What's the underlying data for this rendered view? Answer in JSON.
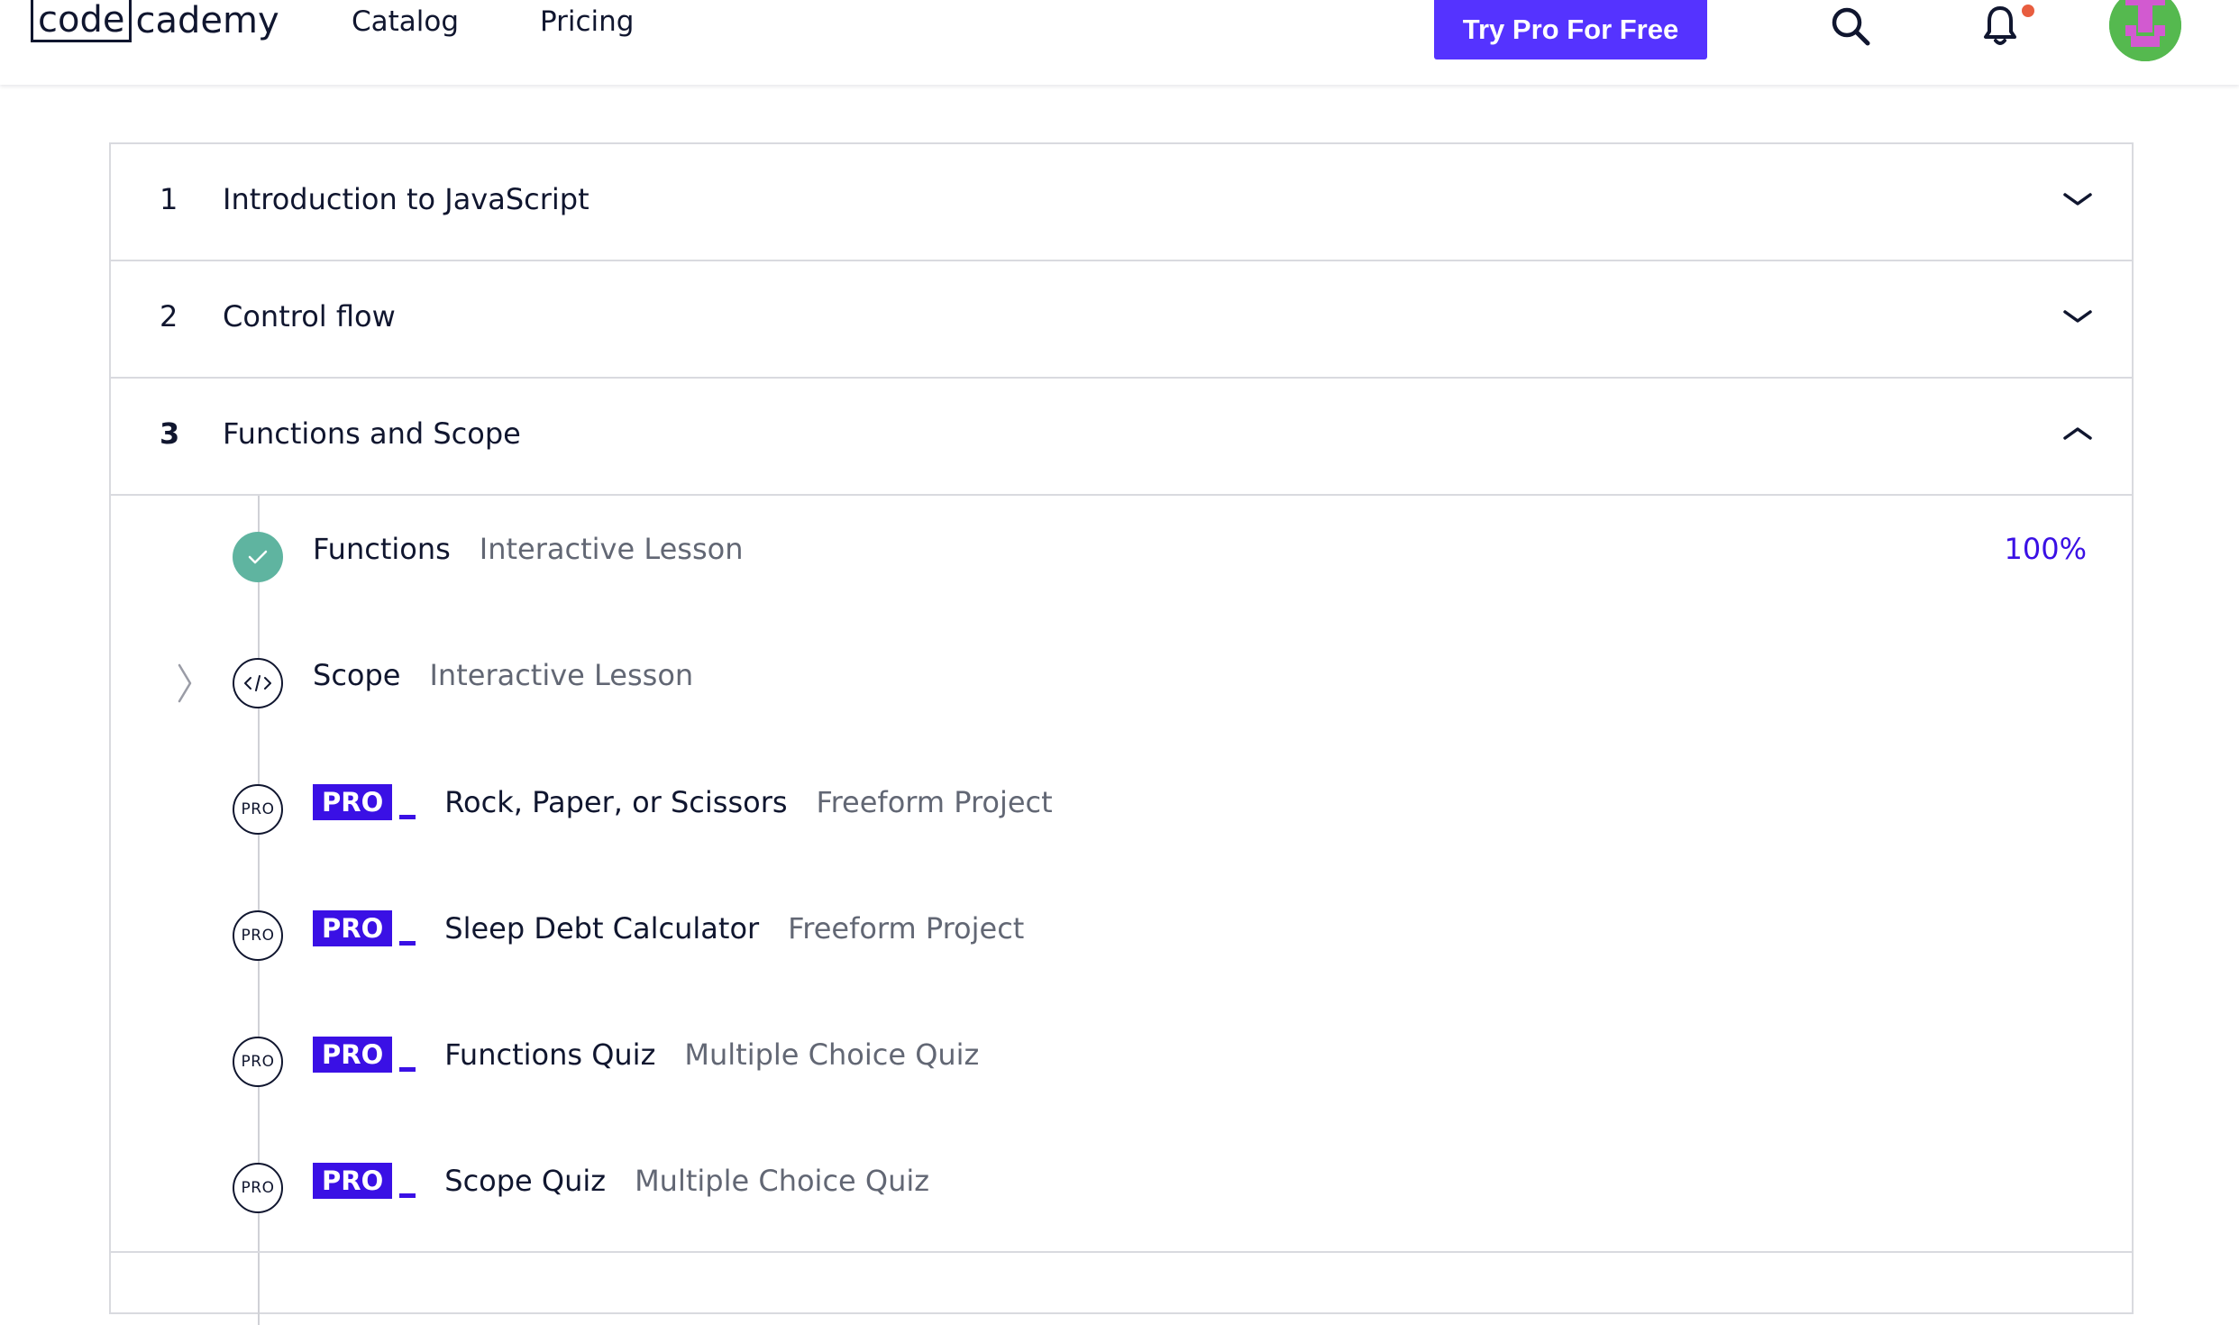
{
  "header": {
    "logo_left": "code",
    "logo_right": "cademy",
    "nav": [
      {
        "label": "Catalog"
      },
      {
        "label": "Pricing"
      }
    ],
    "cta_label": "Try Pro For Free",
    "search_icon": "search-icon",
    "notification_icon": "bell-icon",
    "avatar_icon": "user-avatar"
  },
  "modules": [
    {
      "number": "1",
      "title": "Introduction to JavaScript",
      "state": "collapsed"
    },
    {
      "number": "2",
      "title": "Control flow",
      "state": "collapsed"
    },
    {
      "number": "3",
      "title": "Functions and Scope",
      "state": "expanded"
    }
  ],
  "items": [
    {
      "title": "Functions",
      "type": "Interactive Lesson",
      "status": "complete",
      "progress": "100%"
    },
    {
      "title": "Scope",
      "type": "Interactive Lesson",
      "status": "code"
    },
    {
      "title": "Rock, Paper, or Scissors",
      "type": "Freeform Project",
      "status": "pro",
      "badge": "PRO",
      "ring": "PRO"
    },
    {
      "title": "Sleep Debt Calculator",
      "type": "Freeform Project",
      "status": "pro",
      "badge": "PRO",
      "ring": "PRO"
    },
    {
      "title": "Functions Quiz",
      "type": "Multiple Choice Quiz",
      "status": "pro",
      "badge": "PRO",
      "ring": "PRO"
    },
    {
      "title": "Scope Quiz",
      "type": "Multiple Choice Quiz",
      "status": "pro",
      "badge": "PRO",
      "ring": "PRO"
    }
  ],
  "colors": {
    "brand_purple": "#5533ff",
    "pro_badge": "#3a10e5",
    "complete_green": "#5fb4a0",
    "notification_dot": "#e85d3f",
    "text_dark": "#10162f",
    "text_muted": "#626774"
  }
}
